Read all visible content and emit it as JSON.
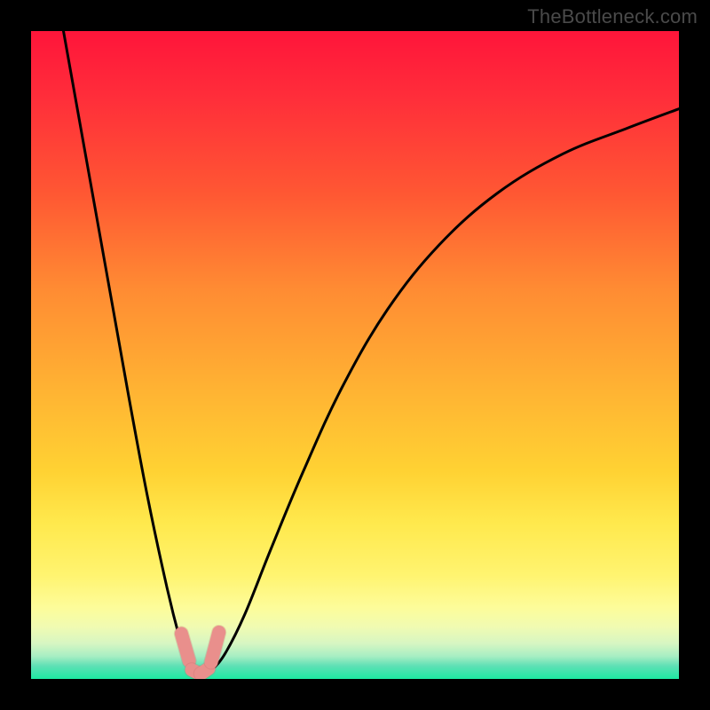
{
  "watermark": "TheBottleneck.com",
  "colors": {
    "curve": "#000000",
    "marker_fill": "#e98f8c",
    "marker_stroke": "#c06a68"
  },
  "chart_data": {
    "type": "line",
    "title": "",
    "xlabel": "",
    "ylabel": "",
    "xlim": [
      0,
      100
    ],
    "ylim": [
      0,
      100
    ],
    "series": [
      {
        "name": "bottleneck-curve",
        "x": [
          5,
          10,
          15,
          18,
          21,
          23,
          24,
          25,
          26,
          27,
          28,
          30,
          33,
          37,
          42,
          48,
          55,
          63,
          72,
          82,
          92,
          100
        ],
        "values": [
          100,
          72,
          44,
          28,
          14,
          6,
          3,
          1.5,
          1,
          1,
          1.5,
          4,
          10,
          20,
          32,
          45,
          57,
          67,
          75,
          81,
          85,
          88
        ]
      }
    ],
    "minimum": {
      "x_range": [
        24,
        28
      ],
      "value": 1
    },
    "markers": [
      {
        "x1": 23.2,
        "y1": 7.0,
        "x2": 24.4,
        "y2": 2.8
      },
      {
        "x1": 24.8,
        "y1": 1.4,
        "x2": 26.0,
        "y2": 0.8
      },
      {
        "x1": 26.2,
        "y1": 0.8,
        "x2": 27.4,
        "y2": 1.6
      },
      {
        "x1": 27.8,
        "y1": 2.6,
        "x2": 29.0,
        "y2": 7.2
      }
    ]
  }
}
